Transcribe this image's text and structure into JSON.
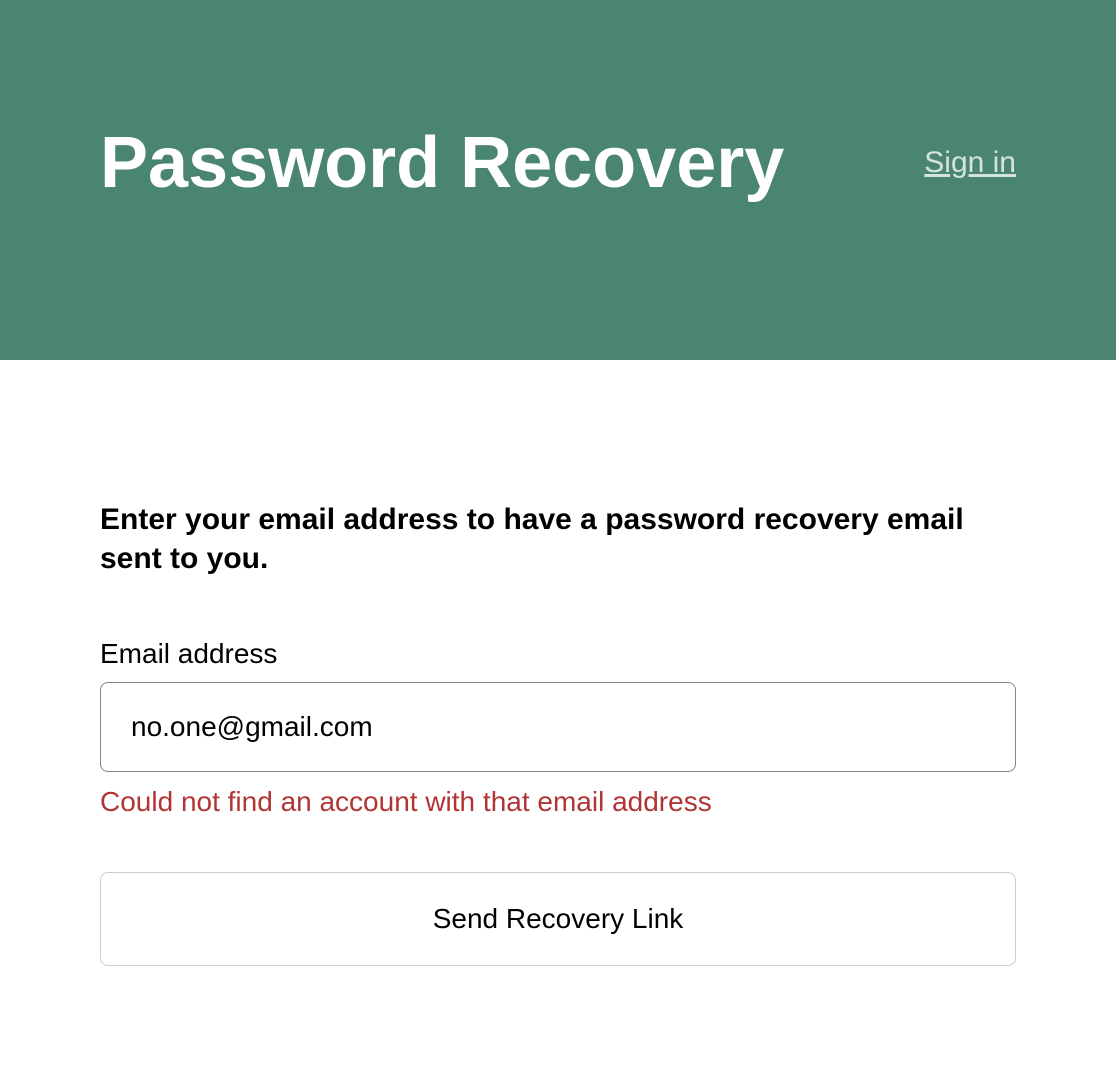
{
  "header": {
    "title": "Password Recovery",
    "signin_link": "Sign in"
  },
  "form": {
    "instruction": "Enter your email address to have a password recovery email sent to you.",
    "email_label": "Email address",
    "email_value": "no.one@gmail.com",
    "error_message": "Could not find an account with that email address",
    "submit_label": "Send Recovery Link"
  }
}
